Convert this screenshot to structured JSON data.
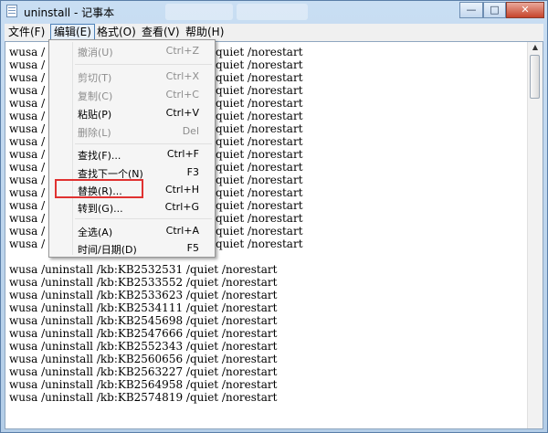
{
  "window": {
    "title": "uninstall - 记事本",
    "minimize_label": "—",
    "maximize_label": "□",
    "close_label": "✕"
  },
  "menubar": {
    "items": [
      "文件(F)",
      "编辑(E)",
      "格式(O)",
      "查看(V)",
      "帮助(H)"
    ],
    "active_index": 1
  },
  "edit_menu": {
    "items": [
      {
        "label": "撤消(U)",
        "shortcut": "Ctrl+Z",
        "enabled": false
      },
      {
        "label": "剪切(T)",
        "shortcut": "Ctrl+X",
        "enabled": false
      },
      {
        "label": "复制(C)",
        "shortcut": "Ctrl+C",
        "enabled": false
      },
      {
        "label": "粘贴(P)",
        "shortcut": "Ctrl+V",
        "enabled": true
      },
      {
        "label": "删除(L)",
        "shortcut": "Del",
        "enabled": false
      },
      {
        "label": "查找(F)...",
        "shortcut": "Ctrl+F",
        "enabled": true
      },
      {
        "label": "查找下一个(N)",
        "shortcut": "F3",
        "enabled": true
      },
      {
        "label": "替换(R)...",
        "shortcut": "Ctrl+H",
        "enabled": true,
        "highlighted": true
      },
      {
        "label": "转到(G)...",
        "shortcut": "Ctrl+G",
        "enabled": true
      },
      {
        "label": "全选(A)",
        "shortcut": "Ctrl+A",
        "enabled": true
      },
      {
        "label": "时间/日期(D)",
        "shortcut": "F5",
        "enabled": true
      }
    ]
  },
  "editor": {
    "lines_partial": [
      {
        "left": "wusa /",
        "right": "quiet /norestart"
      },
      {
        "left": "wusa /",
        "right": "quiet /norestart"
      },
      {
        "left": "wusa /",
        "right": "quiet /norestart"
      },
      {
        "left": "wusa /",
        "right": "quiet /norestart"
      },
      {
        "left": "wusa /",
        "right": "quiet /norestart"
      },
      {
        "left": "wusa /",
        "right": "quiet /norestart"
      },
      {
        "left": "wusa /",
        "right": "quiet /norestart"
      },
      {
        "left": "wusa /",
        "right": "quiet /norestart"
      },
      {
        "left": "wusa /",
        "right": "quiet /norestart"
      },
      {
        "left": "wusa /",
        "right": "quiet /norestart"
      },
      {
        "left": "wusa /",
        "right": "quiet /norestart"
      },
      {
        "left": "wusa /",
        "right": "quiet /norestart"
      },
      {
        "left": "wusa /",
        "right": "quiet /norestart"
      },
      {
        "left": "wusa /",
        "right": "quiet /norestart"
      },
      {
        "left": "wusa /",
        "right": "quiet /norestart"
      },
      {
        "left": "wusa /",
        "right": "quiet /norestart"
      }
    ],
    "lines_full": [
      "wusa /uninstall /kb:KB2532531 /quiet /norestart",
      "wusa /uninstall /kb:KB2533552 /quiet /norestart",
      "wusa /uninstall /kb:KB2533623 /quiet /norestart",
      "wusa /uninstall /kb:KB2534111 /quiet /norestart",
      "wusa /uninstall /kb:KB2545698 /quiet /norestart",
      "wusa /uninstall /kb:KB2547666 /quiet /norestart",
      "wusa /uninstall /kb:KB2552343 /quiet /norestart",
      "wusa /uninstall /kb:KB2560656 /quiet /norestart",
      "wusa /uninstall /kb:KB2563227 /quiet /norestart",
      "wusa /uninstall /kb:KB2564958 /quiet /norestart",
      "wusa /uninstall /kb:KB2574819 /quiet /norestart"
    ]
  },
  "scrollbar": {
    "up_arrow_icon": "arrow-up-icon",
    "down_arrow_icon": "arrow-down-icon"
  },
  "colors": {
    "highlight_box": "#e03231",
    "titlebar": "#bcd4ea"
  }
}
